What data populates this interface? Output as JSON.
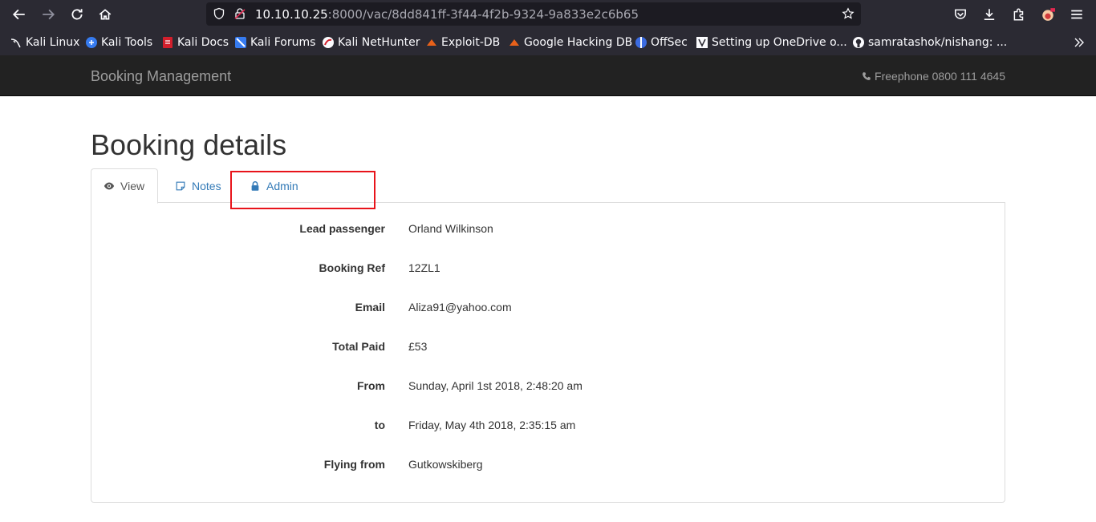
{
  "browser": {
    "url_host": "10.10.10.25",
    "url_rest": ":8000/vac/8dd841ff-3f44-4f2b-9324-9a833e2c6b65",
    "bookmarks": [
      {
        "label": "Kali Linux",
        "icon": "kali-dragon-icon"
      },
      {
        "label": "Kali Tools",
        "icon": "kali-tools-icon"
      },
      {
        "label": "Kali Docs",
        "icon": "kali-docs-icon"
      },
      {
        "label": "Kali Forums",
        "icon": "kali-forums-icon"
      },
      {
        "label": "Kali NetHunter",
        "icon": "nethunter-icon"
      },
      {
        "label": "Exploit-DB",
        "icon": "exploit-db-icon"
      },
      {
        "label": "Google Hacking DB",
        "icon": "ghdb-icon"
      },
      {
        "label": "OffSec",
        "icon": "offsec-icon"
      },
      {
        "label": "Setting up OneDrive o...",
        "icon": "onedrive-page-icon"
      },
      {
        "label": "samratashok/nishang: ...",
        "icon": "github-icon"
      }
    ]
  },
  "navbar": {
    "brand": "Booking Management",
    "phone": "Freephone 0800 111 4645"
  },
  "page": {
    "title": "Booking details"
  },
  "tabs": [
    {
      "label": "View",
      "icon": "eye-icon",
      "active": true
    },
    {
      "label": "Notes",
      "icon": "note-icon",
      "active": false
    },
    {
      "label": "Admin",
      "icon": "lock-icon",
      "active": false
    }
  ],
  "highlight_color": "#e8141b",
  "details": [
    {
      "key": "Lead passenger",
      "value": "Orland Wilkinson"
    },
    {
      "key": "Booking Ref",
      "value": "12ZL1"
    },
    {
      "key": "Email",
      "value": "Aliza91@yahoo.com"
    },
    {
      "key": "Total Paid",
      "value": "£53"
    },
    {
      "key": "From",
      "value": "Sunday, April 1st 2018, 2:48:20 am"
    },
    {
      "key": "to",
      "value": "Friday, May 4th 2018, 2:35:15 am"
    },
    {
      "key": "Flying from",
      "value": "Gutkowskiberg"
    }
  ]
}
